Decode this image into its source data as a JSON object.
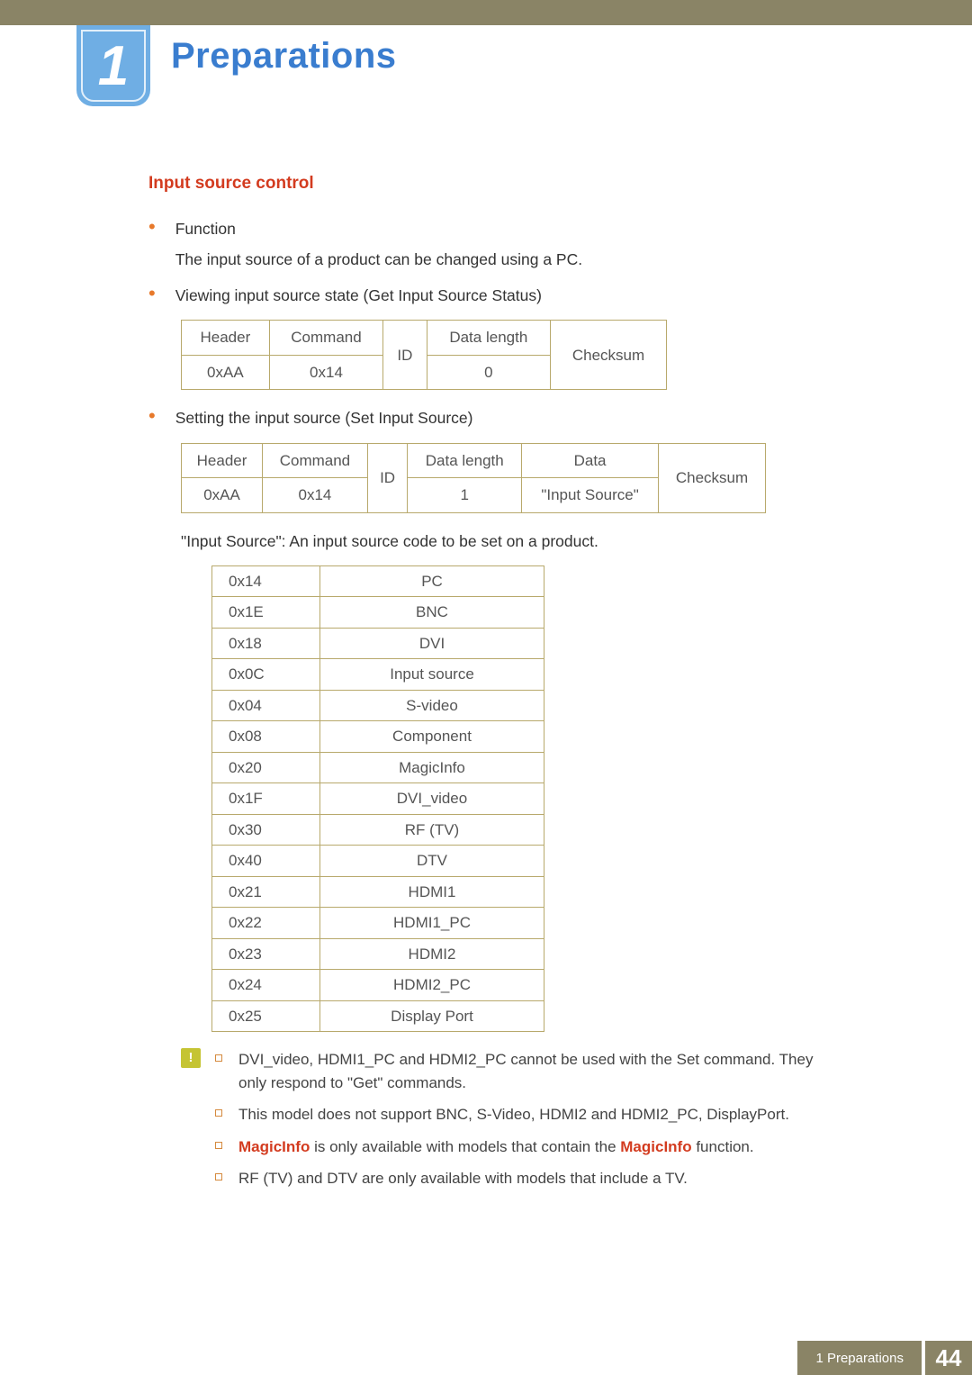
{
  "chapter": {
    "number": "1",
    "title": "Preparations"
  },
  "section": {
    "heading": "Input source control"
  },
  "bullets": {
    "b1_label": "Function",
    "b1_text": "The input source of a product can be changed using a PC.",
    "b2_label": "Viewing input source state (Get Input Source Status)",
    "b3_label": "Setting the input source (Set Input Source)",
    "after_t2": "\"Input Source\": An input source code to be set on a product."
  },
  "table1": {
    "h": [
      "Header",
      "Command",
      "ID",
      "Data length",
      "Checksum"
    ],
    "r1": [
      "0xAA",
      "0x14",
      "",
      "0",
      ""
    ]
  },
  "table2": {
    "h": [
      "Header",
      "Command",
      "ID",
      "Data length",
      "Data",
      "Checksum"
    ],
    "r1": [
      "0xAA",
      "0x14",
      "",
      "1",
      "\"Input Source\"",
      ""
    ]
  },
  "table3": {
    "rows": [
      [
        "0x14",
        "PC"
      ],
      [
        "0x1E",
        "BNC"
      ],
      [
        "0x18",
        "DVI"
      ],
      [
        "0x0C",
        "Input source"
      ],
      [
        "0x04",
        "S-video"
      ],
      [
        "0x08",
        "Component"
      ],
      [
        "0x20",
        "MagicInfo"
      ],
      [
        "0x1F",
        "DVI_video"
      ],
      [
        "0x30",
        "RF (TV)"
      ],
      [
        "0x40",
        "DTV"
      ],
      [
        "0x21",
        "HDMI1"
      ],
      [
        "0x22",
        "HDMI1_PC"
      ],
      [
        "0x23",
        "HDMI2"
      ],
      [
        "0x24",
        "HDMI2_PC"
      ],
      [
        "0x25",
        "Display Port"
      ]
    ]
  },
  "notes": {
    "n1": "DVI_video, HDMI1_PC and HDMI2_PC cannot be used with the Set command. They only respond to \"Get\" commands.",
    "n2": "This model does not support BNC, S-Video, HDMI2 and HDMI2_PC, DisplayPort.",
    "n3_pre": "MagicInfo",
    "n3_mid": " is only available with models that contain the ",
    "n3_suf": "MagicInfo",
    "n3_end": " function.",
    "n4": "RF (TV) and DTV are only available with models that include a TV."
  },
  "footer": {
    "label": "1 Preparations",
    "page": "44"
  },
  "icon": {
    "warn_glyph": "!"
  }
}
